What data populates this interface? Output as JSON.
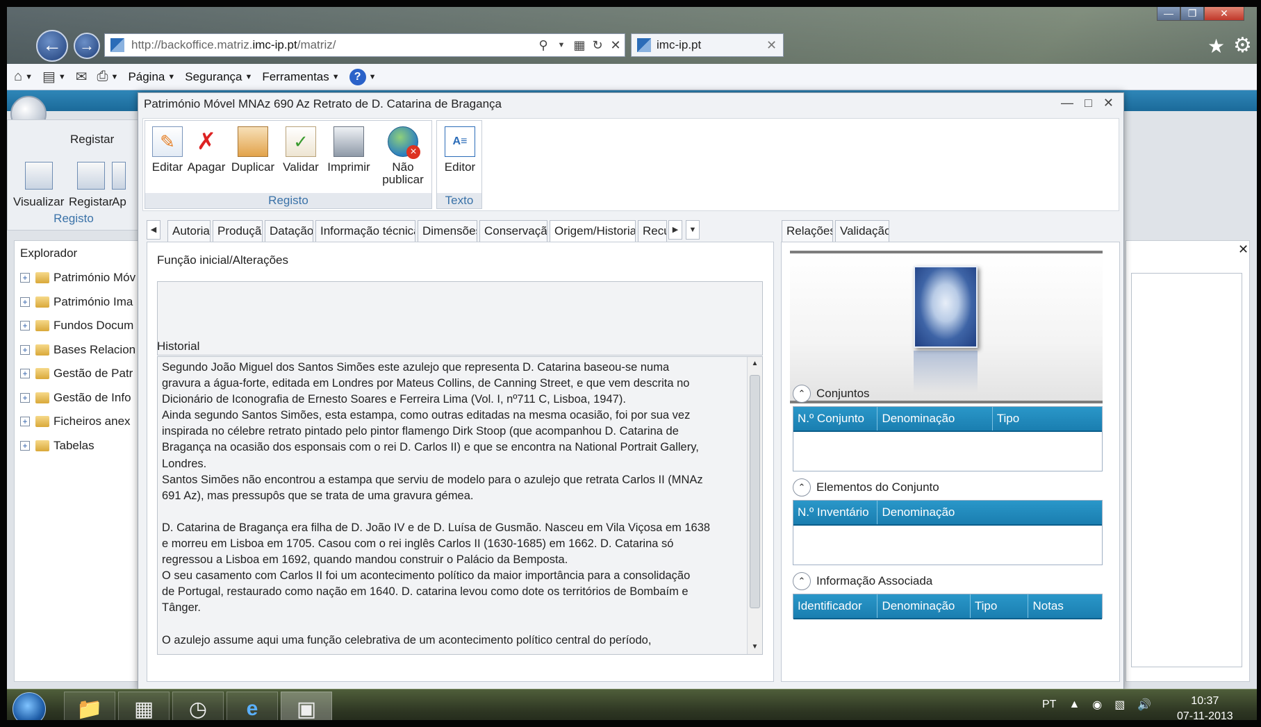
{
  "browser": {
    "url_prefix": "http://backoffice.matriz.",
    "url_host": "imc-ip.pt",
    "url_suffix": "/matriz/",
    "tab_title": "imc-ip.pt",
    "command_bar": {
      "page": "Página",
      "security": "Segurança",
      "tools": "Ferramentas"
    }
  },
  "background_app": {
    "ribbon_title": "Registar",
    "buttons": [
      "Visualizar",
      "Registar",
      "Ap"
    ],
    "group_label": "Registo",
    "explorer_title": "Explorador",
    "tree": [
      "Património Móv",
      "Património Ima",
      "Fundos Docum",
      "Bases Relacion",
      "Gestão de Patr",
      "Gestão de Info",
      "Ficheiros anex",
      "Tabelas"
    ]
  },
  "dialog": {
    "title": "Património Móvel MNAz 690 Az Retrato de D. Catarina de Bragança",
    "ribbon": {
      "registo_buttons": [
        {
          "label": "Editar",
          "icon": "edit-icon"
        },
        {
          "label": "Apagar",
          "icon": "delete-icon"
        },
        {
          "label": "Duplicar",
          "icon": "duplicate-icon"
        },
        {
          "label": "Validar",
          "icon": "validate-icon"
        },
        {
          "label": "Imprimir",
          "icon": "print-icon"
        },
        {
          "label": "Não publicar",
          "icon": "unpublish-globe-icon"
        }
      ],
      "registo_label": "Registo",
      "texto_button": "Editor",
      "texto_label": "Texto"
    },
    "tabs_left": [
      "Autoria",
      "Produção",
      "Datação",
      "Informação técnica",
      "Dimensões",
      "Conservação",
      "Origem/Historial",
      "Recu"
    ],
    "active_tab": "Origem/Historial",
    "tabs_right": [
      "Relações",
      "Validação"
    ],
    "funcao_label": "Função inicial/Alterações",
    "funcao_value": "",
    "historial_label": "Historial",
    "historial_text": "Segundo João Miguel dos Santos Simões este azulejo que representa D. Catarina baseou-se numa\ngravura a água-forte, editada em Londres por Mateus Collins, de Canning Street, e que vem descrita no\nDicionário de Iconografia de Ernesto Soares e Ferreira Lima (Vol. I, nº711 C, Lisboa, 1947).\nAinda segundo Santos Simões, esta estampa, como outras editadas na mesma ocasião, foi por sua vez\ninspirada no célebre retrato pintado pelo pintor flamengo Dirk Stoop (que acompanhou D. Catarina de\nBragança na ocasião dos esponsais com o rei D. Carlos II) e que se encontra na National Portrait Gallery,\nLondres.\nSantos Simões não encontrou a estampa que serviu de modelo para o azulejo que retrata Carlos II (MNAz\n691 Az), mas pressupôs que se trata de uma gravura gémea.\n\nD. Catarina de Bragança era filha de D. João IV e de D. Luísa de Gusmão. Nasceu em Vila Viçosa em 1638\ne morreu em Lisboa em 1705. Casou com o rei inglês Carlos II (1630-1685) em 1662. D. Catarina só\nregressou a Lisboa em 1692, quando mandou construir o Palácio da Bemposta.\nO seu casamento com Carlos II foi um acontecimento político da maior importância para a consolidação\nde Portugal, restaurado como nação em 1640. D. catarina levou como dote os territórios de Bombaím e\nTânger.\n\nO azulejo assume aqui uma função celebrativa de um acontecimento político central do período,",
    "conjuntos": {
      "title": "Conjuntos",
      "columns": [
        "N.º Conjunto",
        "Denominação",
        "Tipo"
      ]
    },
    "elementos": {
      "title": "Elementos do Conjunto",
      "columns": [
        "N.º Inventário",
        "Denominação"
      ]
    },
    "informacao": {
      "title": "Informação Associada",
      "columns": [
        "Identificador",
        "Denominação",
        "Tipo",
        "Notas"
      ]
    }
  },
  "taskbar": {
    "language": "PT",
    "time": "10:37",
    "date": "07-11-2013"
  }
}
